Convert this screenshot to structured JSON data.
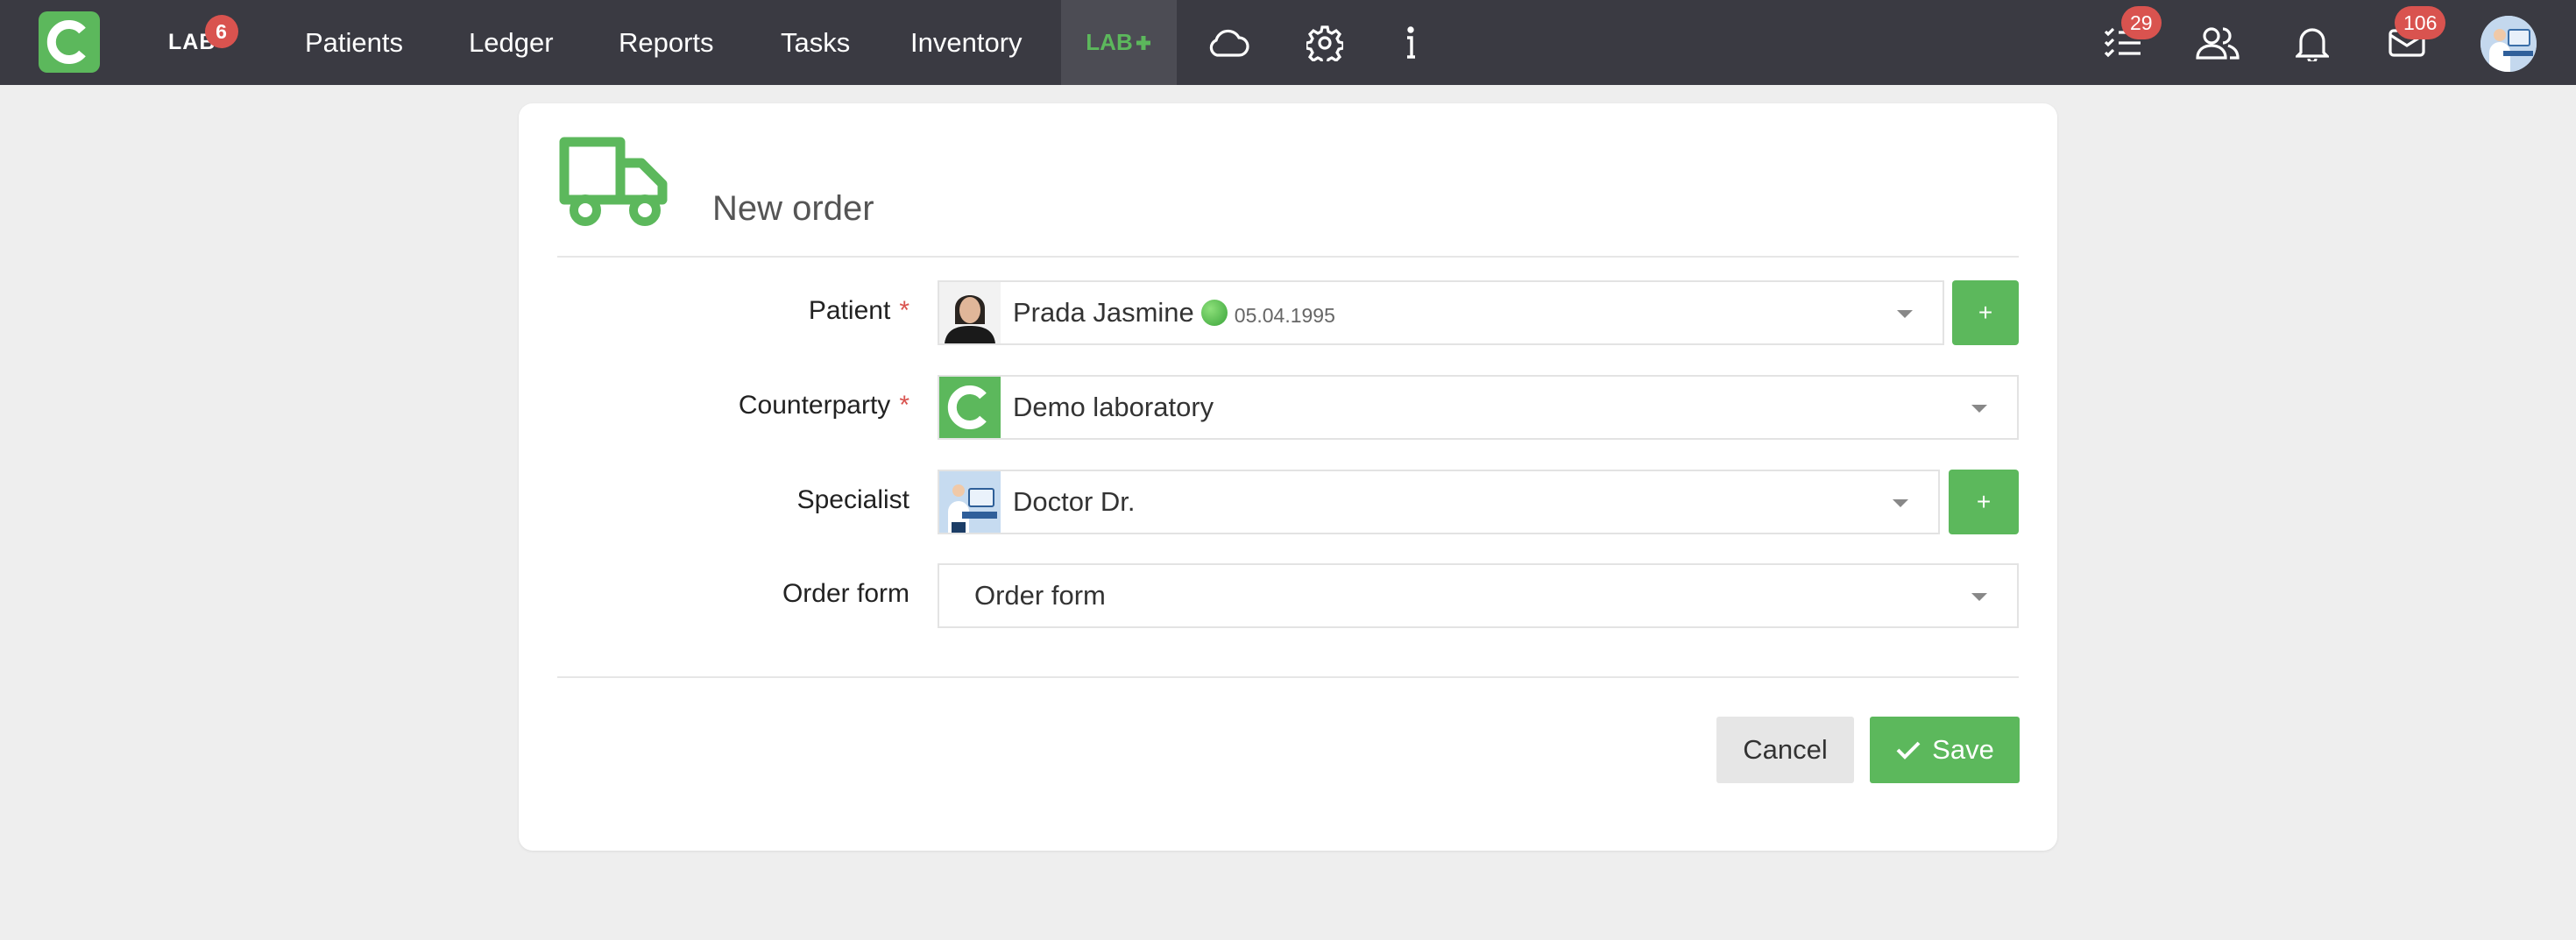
{
  "navbar": {
    "lab_label": "LAB",
    "lab_badge": "6",
    "items": [
      {
        "label": "Patients"
      },
      {
        "label": "Ledger"
      },
      {
        "label": "Reports"
      },
      {
        "label": "Tasks"
      },
      {
        "label": "Inventory"
      }
    ],
    "labplus_label": "LAB",
    "tasks_badge": "29",
    "mail_badge": "106",
    "icons": [
      "app-logo-icon",
      "cloud-icon",
      "gear-icon",
      "info-icon",
      "tasks-icon",
      "users-icon",
      "bell-icon",
      "mail-icon"
    ]
  },
  "form": {
    "title": "New order",
    "patient": {
      "label": "Patient",
      "required_mark": "*",
      "name": "Prada Jasmine",
      "dob": "05.04.1995",
      "add_label": "+"
    },
    "counterparty": {
      "label": "Counterparty",
      "required_mark": "*",
      "value": "Demo laboratory"
    },
    "specialist": {
      "label": "Specialist",
      "value": "Doctor Dr.",
      "add_label": "+"
    },
    "order_form": {
      "label": "Order form",
      "value": "Order form"
    },
    "cancel_label": "Cancel",
    "save_label": "Save"
  },
  "colors": {
    "navbar": "#3a3a42",
    "accent_green": "#5cb85c",
    "badge_red": "#d9534f",
    "background": "#eeeeee"
  }
}
